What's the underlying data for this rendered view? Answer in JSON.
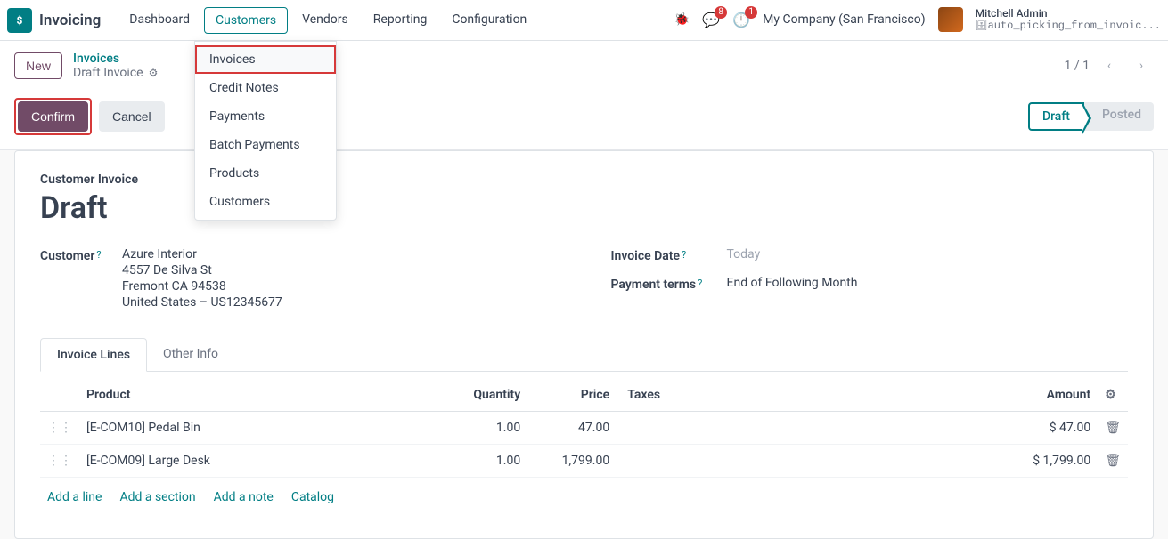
{
  "app": {
    "name": "Invoicing"
  },
  "nav": {
    "items": [
      {
        "label": "Dashboard"
      },
      {
        "label": "Customers"
      },
      {
        "label": "Vendors"
      },
      {
        "label": "Reporting"
      },
      {
        "label": "Configuration"
      }
    ]
  },
  "dropdown": {
    "items": [
      {
        "label": "Invoices"
      },
      {
        "label": "Credit Notes"
      },
      {
        "label": "Payments"
      },
      {
        "label": "Batch Payments"
      },
      {
        "label": "Products"
      },
      {
        "label": "Customers"
      }
    ]
  },
  "topbar_right": {
    "chat_badge": "8",
    "clock_badge": "1",
    "company": "My Company (San Francisco)",
    "user_name": "Mitchell Admin",
    "user_db": "auto_picking_from_invoic..."
  },
  "controls": {
    "new_label": "New",
    "breadcrumb_link": "Invoices",
    "breadcrumb_current": "Draft Invoice",
    "pager": "1 / 1"
  },
  "actions": {
    "confirm": "Confirm",
    "cancel": "Cancel",
    "status_draft": "Draft",
    "status_posted": "Posted"
  },
  "sheet": {
    "title": "Customer Invoice",
    "state": "Draft",
    "customer_label": "Customer",
    "customer_name": "Azure Interior",
    "addr1": "4557 De Silva St",
    "addr2": "Fremont CA 94538",
    "addr3": "United States – US12345677",
    "invoice_date_label": "Invoice Date",
    "invoice_date_value": "Today",
    "payment_terms_label": "Payment terms",
    "payment_terms_value": "End of Following Month"
  },
  "tabs": {
    "invoice_lines": "Invoice Lines",
    "other_info": "Other Info"
  },
  "table": {
    "headers": {
      "product": "Product",
      "quantity": "Quantity",
      "price": "Price",
      "taxes": "Taxes",
      "amount": "Amount"
    },
    "rows": [
      {
        "product": "[E-COM10] Pedal Bin",
        "qty": "1.00",
        "price": "47.00",
        "taxes": "",
        "amount": "$ 47.00"
      },
      {
        "product": "[E-COM09] Large Desk",
        "qty": "1.00",
        "price": "1,799.00",
        "taxes": "",
        "amount": "$ 1,799.00"
      }
    ]
  },
  "line_actions": {
    "add_line": "Add a line",
    "add_section": "Add a section",
    "add_note": "Add a note",
    "catalog": "Catalog"
  }
}
